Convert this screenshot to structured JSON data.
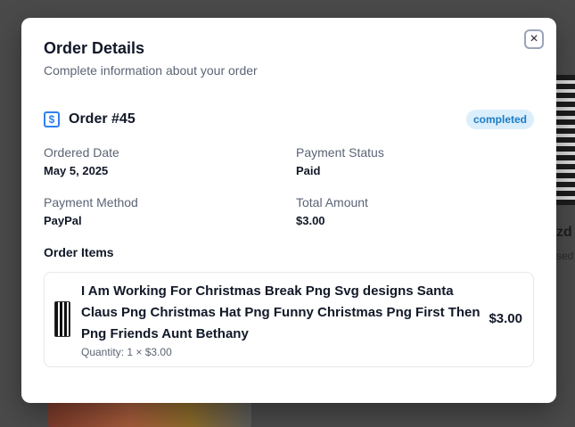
{
  "background": {
    "right_snippet_title": "zd",
    "right_snippet_sub": "sed"
  },
  "modal": {
    "title": "Order Details",
    "subtitle": "Complete information about your order",
    "close_icon": "×",
    "order": {
      "number": "Order #45",
      "icon": "$",
      "status": "completed"
    },
    "fields": {
      "ordered_date_label": "Ordered Date",
      "ordered_date_value": "May 5, 2025",
      "payment_status_label": "Payment Status",
      "payment_status_value": "Paid",
      "payment_method_label": "Payment Method",
      "payment_method_value": "PayPal",
      "total_amount_label": "Total Amount",
      "total_amount_value": "$3.00"
    },
    "items_heading": "Order Items",
    "items": [
      {
        "title": "I Am Working For Christmas Break Png Svg designs Santa Claus Png Christmas Hat Png Funny Christmas Png First Then Png Friends Aunt Bethany",
        "quantity": "Quantity: 1 × $3.00",
        "price": "$3.00"
      }
    ]
  },
  "colors": {
    "accent": "#2f80ed",
    "badge_bg": "#dbeefb",
    "badge_text": "#1a7cc4"
  }
}
